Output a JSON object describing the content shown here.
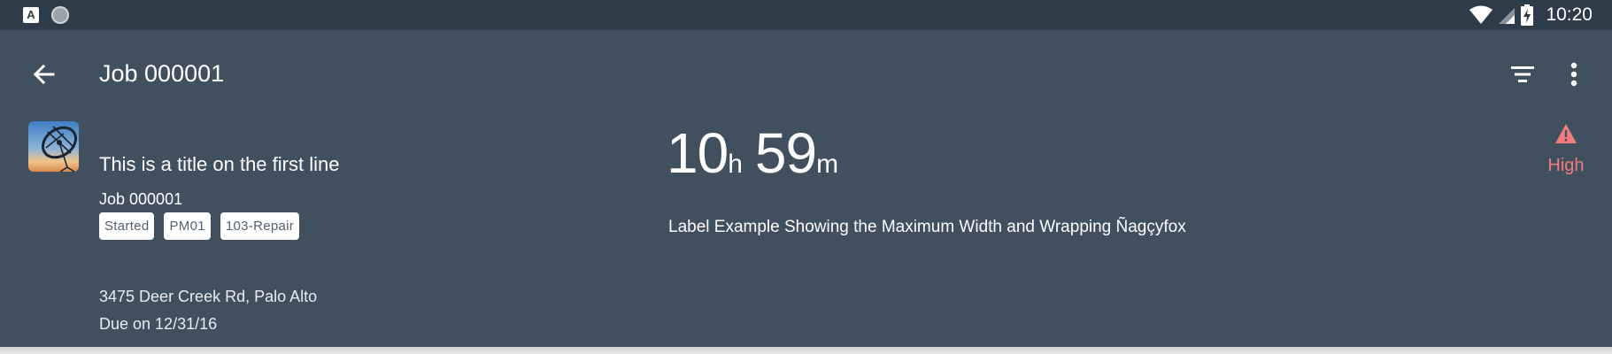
{
  "status_bar": {
    "left_icons": [
      "a-badge-icon",
      "record-dot-icon"
    ],
    "badge_letter": "A",
    "right_icons": [
      "wifi-icon",
      "signal-icon",
      "battery-charging-icon"
    ],
    "time": "10:20"
  },
  "app_bar": {
    "title": "Job 000001",
    "icons": [
      "back-arrow-icon",
      "filter-icon",
      "more-vert-icon"
    ]
  },
  "object": {
    "title": "This is a title on the first line",
    "subtitle": "Job 000001",
    "tags": [
      "Started",
      "PM01",
      "103-Repair"
    ],
    "address": "3475 Deer Creek Rd, Palo Alto",
    "due": "Due on 12/31/16"
  },
  "kpi": {
    "hours": "10",
    "hours_unit": "h",
    "minutes": "59",
    "minutes_unit": "m",
    "label": "Label Example Showing the Maximum Width and Wrapping Ñagçyfox"
  },
  "priority": {
    "label": "High",
    "icon": "warning-icon",
    "color": "#f27b7b"
  },
  "colors": {
    "status_bar": "#2e3b49",
    "header_background": "#41505f",
    "text": "#ffffff",
    "tag_background": "#ffffff",
    "tag_text": "#556270"
  }
}
